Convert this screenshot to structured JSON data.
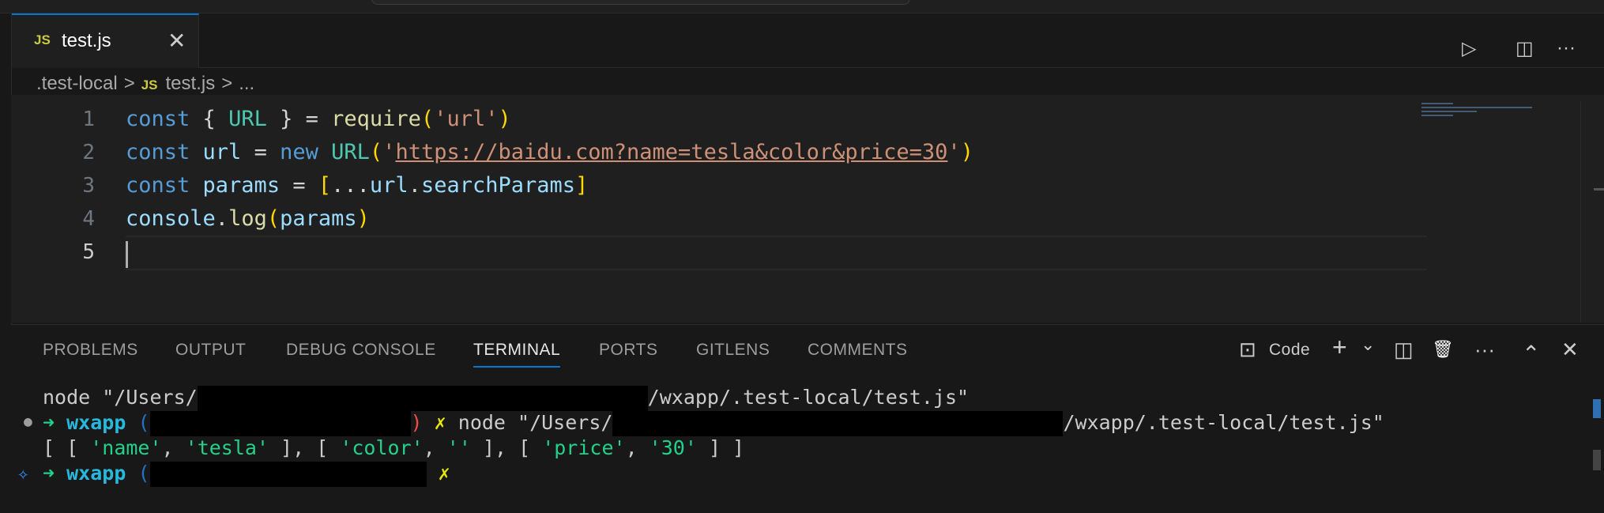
{
  "tab": {
    "icon": "JS",
    "name": "test.js",
    "close": "✕"
  },
  "toolbar": {
    "run": "▷",
    "split": "◫",
    "more": "···"
  },
  "breadcrumb": {
    "folder": ".test-local",
    "sep": ">",
    "file_icon": "JS",
    "file": "test.js",
    "ellipsis": "..."
  },
  "editor": {
    "lines": [
      {
        "num": "1"
      },
      {
        "num": "2"
      },
      {
        "num": "3"
      },
      {
        "num": "4"
      },
      {
        "num": "5"
      }
    ],
    "code": {
      "l1": {
        "kw": "const",
        "open": " { ",
        "cls": "URL",
        "close": " } = ",
        "fn": "require",
        "p1": "(",
        "str": "'url'",
        "p2": ")"
      },
      "l2": {
        "kw": "const",
        "var": " url",
        "eq": " = ",
        "kw2": "new",
        "cls": " URL",
        "p1": "(",
        "q1": "'",
        "url": "https://baidu.com?name=tesla&color&price=30",
        "q2": "'",
        "p2": ")"
      },
      "l3": {
        "kw": "const",
        "var": " params",
        "eq": " = ",
        "b1": "[",
        "dots": "...",
        "var2": "url",
        "dot": ".",
        "prop": "searchParams",
        "b2": "]"
      },
      "l4": {
        "obj": "console",
        "dot": ".",
        "fn": "log",
        "p1": "(",
        "var": "params",
        "p2": ")"
      }
    }
  },
  "panel": {
    "tabs": [
      "PROBLEMS",
      "OUTPUT",
      "DEBUG CONSOLE",
      "TERMINAL",
      "PORTS",
      "GITLENS",
      "COMMENTS"
    ],
    "active_tab": "TERMINAL",
    "shell_label": "Code",
    "icons": {
      "terminal": "⊡",
      "add": "+",
      "dropdown": "⌄",
      "split": "◫",
      "trash": "🗑",
      "more": "···",
      "maximize": "⌃",
      "close": "✕"
    }
  },
  "terminal": {
    "line1": {
      "cmd": "node \"/Users/",
      "path": "/wxapp/.test-local/test.js\""
    },
    "line2": {
      "arrow": "➜",
      "dir": "wxapp",
      "git_open": "(",
      "git_close": ")",
      "x": "✗",
      "cmd": "node \"/Users/",
      "path": "/wxapp/.test-local/test.js\""
    },
    "line3": {
      "p1": "[ [ ",
      "s1": "'name'",
      "c1": ", ",
      "s2": "'tesla'",
      "p2": " ], [ ",
      "s3": "'color'",
      "c2": ", ",
      "s4": "''",
      "p3": " ], [ ",
      "s5": "'price'",
      "c3": ", ",
      "s6": "'30'",
      "p4": " ] ]"
    },
    "line4": {
      "arrow": "➜",
      "dir": "wxapp",
      "git_open": "(",
      "x": "✗"
    }
  },
  "colors": {
    "accent": "#0078d4",
    "background": "#1f1f1f"
  }
}
